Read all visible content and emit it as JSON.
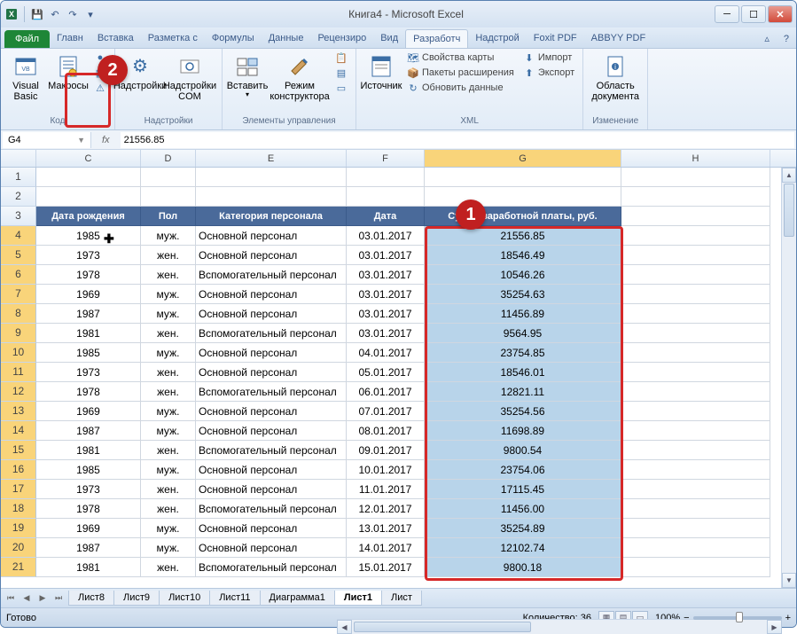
{
  "title": "Книга4 - Microsoft Excel",
  "tabs": {
    "file": "Файл",
    "items": [
      "Главн",
      "Вставка",
      "Разметка с",
      "Формулы",
      "Данные",
      "Рецензиро",
      "Вид",
      "Разработч",
      "Надстрой",
      "Foxit PDF",
      "ABBYY PDF"
    ],
    "active_index": 7
  },
  "ribbon": {
    "group_code": {
      "label": "Код",
      "visual_basic": "Visual Basic",
      "macros": "Макросы"
    },
    "group_addins": {
      "label": "Надстройки",
      "addins": "Надстройки",
      "com": "Надстройки COM"
    },
    "group_controls": {
      "label": "Элементы управления",
      "insert": "Вставить",
      "design": "Режим конструктора"
    },
    "group_xml": {
      "label": "XML",
      "source": "Источник",
      "map_props": "Свойства карты",
      "expansion": "Пакеты расширения",
      "refresh": "Обновить данные",
      "import": "Импорт",
      "export": "Экспорт"
    },
    "group_modify": {
      "label": "Изменение",
      "doc_area": "Область документа"
    }
  },
  "name_box": "G4",
  "formula": "21556.85",
  "columns": [
    "C",
    "D",
    "E",
    "F",
    "G",
    "H"
  ],
  "headers": {
    "c": "Дата рождения",
    "d": "Пол",
    "e": "Категория персонала",
    "f": "Дата",
    "g": "Сумма заработной платы, руб."
  },
  "rows": [
    {
      "n": 4,
      "c": "1985",
      "d": "муж.",
      "e": "Основной персонал",
      "f": "03.01.2017",
      "g": "21556.85"
    },
    {
      "n": 5,
      "c": "1973",
      "d": "жен.",
      "e": "Основной персонал",
      "f": "03.01.2017",
      "g": "18546.49"
    },
    {
      "n": 6,
      "c": "1978",
      "d": "жен.",
      "e": "Вспомогательный персонал",
      "f": "03.01.2017",
      "g": "10546.26"
    },
    {
      "n": 7,
      "c": "1969",
      "d": "муж.",
      "e": "Основной персонал",
      "f": "03.01.2017",
      "g": "35254.63"
    },
    {
      "n": 8,
      "c": "1987",
      "d": "муж.",
      "e": "Основной персонал",
      "f": "03.01.2017",
      "g": "11456.89"
    },
    {
      "n": 9,
      "c": "1981",
      "d": "жен.",
      "e": "Вспомогательный персонал",
      "f": "03.01.2017",
      "g": "9564.95"
    },
    {
      "n": 10,
      "c": "1985",
      "d": "муж.",
      "e": "Основной персонал",
      "f": "04.01.2017",
      "g": "23754.85"
    },
    {
      "n": 11,
      "c": "1973",
      "d": "жен.",
      "e": "Основной персонал",
      "f": "05.01.2017",
      "g": "18546.01"
    },
    {
      "n": 12,
      "c": "1978",
      "d": "жен.",
      "e": "Вспомогательный персонал",
      "f": "06.01.2017",
      "g": "12821.11"
    },
    {
      "n": 13,
      "c": "1969",
      "d": "муж.",
      "e": "Основной персонал",
      "f": "07.01.2017",
      "g": "35254.56"
    },
    {
      "n": 14,
      "c": "1987",
      "d": "муж.",
      "e": "Основной персонал",
      "f": "08.01.2017",
      "g": "11698.89"
    },
    {
      "n": 15,
      "c": "1981",
      "d": "жен.",
      "e": "Вспомогательный персонал",
      "f": "09.01.2017",
      "g": "9800.54"
    },
    {
      "n": 16,
      "c": "1985",
      "d": "муж.",
      "e": "Основной персонал",
      "f": "10.01.2017",
      "g": "23754.06"
    },
    {
      "n": 17,
      "c": "1973",
      "d": "жен.",
      "e": "Основной персонал",
      "f": "11.01.2017",
      "g": "17115.45"
    },
    {
      "n": 18,
      "c": "1978",
      "d": "жен.",
      "e": "Вспомогательный персонал",
      "f": "12.01.2017",
      "g": "11456.00"
    },
    {
      "n": 19,
      "c": "1969",
      "d": "муж.",
      "e": "Основной персонал",
      "f": "13.01.2017",
      "g": "35254.89"
    },
    {
      "n": 20,
      "c": "1987",
      "d": "муж.",
      "e": "Основной персонал",
      "f": "14.01.2017",
      "g": "12102.74"
    },
    {
      "n": 21,
      "c": "1981",
      "d": "жен.",
      "e": "Вспомогательный персонал",
      "f": "15.01.2017",
      "g": "9800.18"
    }
  ],
  "sheets": [
    "Лист8",
    "Лист9",
    "Лист10",
    "Лист11",
    "Диаграмма1",
    "Лист1",
    "Лист"
  ],
  "active_sheet": 5,
  "status": {
    "ready": "Готово",
    "count_label": "Количество: 36",
    "zoom": "100%"
  },
  "callouts": {
    "one": "1",
    "two": "2"
  }
}
